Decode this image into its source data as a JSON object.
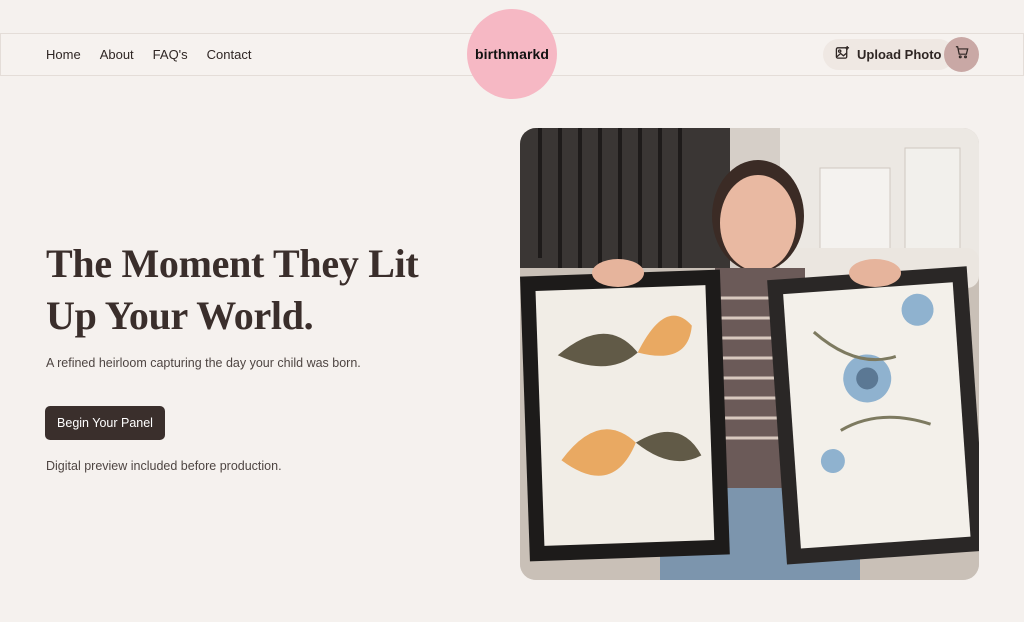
{
  "nav": {
    "links": [
      "Home",
      "About",
      "FAQ's",
      "Contact"
    ]
  },
  "logo": {
    "text": "birthmarkd",
    "bg_color": "#f6b8c4"
  },
  "header_actions": {
    "upload_label": "Upload Photo",
    "upload_icon": "image-plus-icon",
    "cart_icon": "cart-icon"
  },
  "hero": {
    "headline_line1": "The Moment They Lit",
    "headline_line2": "Up Your World.",
    "subtext": "A refined heirloom capturing the day your child was born.",
    "cta_label": "Begin Your Panel",
    "note": "Digital preview included before production.",
    "image_icon": "photo-woman-holding-two-framed-prints"
  },
  "colors": {
    "background": "#f5f1ee",
    "cta": "#3a2f2c",
    "cart": "#c9a8a5"
  }
}
